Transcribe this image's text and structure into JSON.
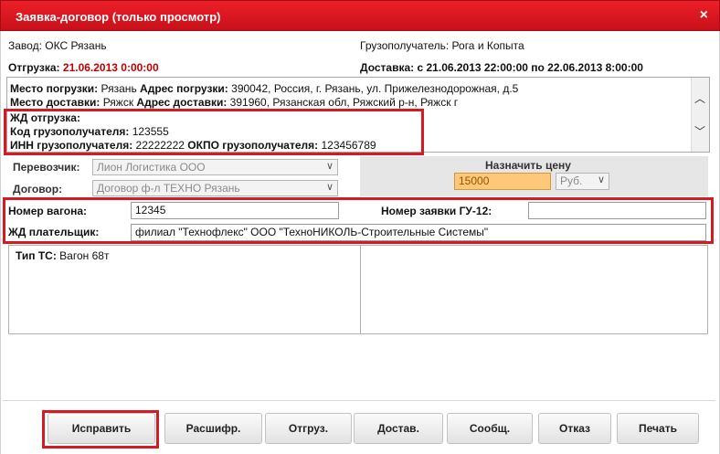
{
  "window": {
    "title": "Заявка-договор (только просмотр)",
    "close_glyph": "×"
  },
  "header": {
    "plant_label": "Завод:",
    "plant_value": "ОКС Рязань",
    "consignee_label": "Грузополучатель:",
    "consignee_value": "Рога и Копыта",
    "shipment_label": "Отгрузка:",
    "shipment_value": "21.06.2013 0:00:00",
    "delivery_label": "Доставка:",
    "delivery_value": "с 21.06.2013 22:00:00 по 22.06.2013 8:00:00"
  },
  "info": {
    "load_place_label": "Место погрузки:",
    "load_place_value": "Рязань",
    "load_addr_label": "Адрес погрузки:",
    "load_addr_value": "390042, Россия, г. Рязань, ул. Прижелезнодорожная, д.5",
    "deliv_place_label": "Место доставки:",
    "deliv_place_value": "Ряжск",
    "deliv_addr_label": "Адрес доставки:",
    "deliv_addr_value": "391960, Рязанская обл, Ряжский р-н, Ряжск г",
    "rail_label": "ЖД отгрузка:",
    "consignee_code_label": "Код грузополучателя:",
    "consignee_code_value": "123555",
    "inn_label": "ИНН грузополучателя:",
    "inn_value": "22222222",
    "okpo_label": "ОКПО грузополучателя:",
    "okpo_value": "123456789"
  },
  "form": {
    "carrier_label": "Перевозчик:",
    "carrier_value": "Лион Логистика ООО",
    "contract_label": "Договор:",
    "contract_value": "Договор ф-л ТЕХНО Рязань",
    "price_title": "Назначить цену",
    "price_value": "15000",
    "currency_value": "Руб.",
    "wagon_label": "Номер вагона:",
    "wagon_value": "12345",
    "gu12_label": "Номер заявки ГУ-12:",
    "gu12_value": "",
    "payer_label": "ЖД плательщик:",
    "payer_value": "филиал \"Технофлекс\" ООО \"ТехноНИКОЛЬ-Строительные Системы\"",
    "ts_type_label": "Тип ТС:",
    "ts_type_value": "Вагон 68т"
  },
  "buttons": {
    "fix": "Исправить",
    "decode": "Расшифр.",
    "ship": "Отгруз.",
    "deliver": "Достав.",
    "message": "Сообщ.",
    "reject": "Отказ",
    "print": "Печать"
  },
  "colors": {
    "accent_red": "#d51a24",
    "price_field": "#ffc77a"
  }
}
